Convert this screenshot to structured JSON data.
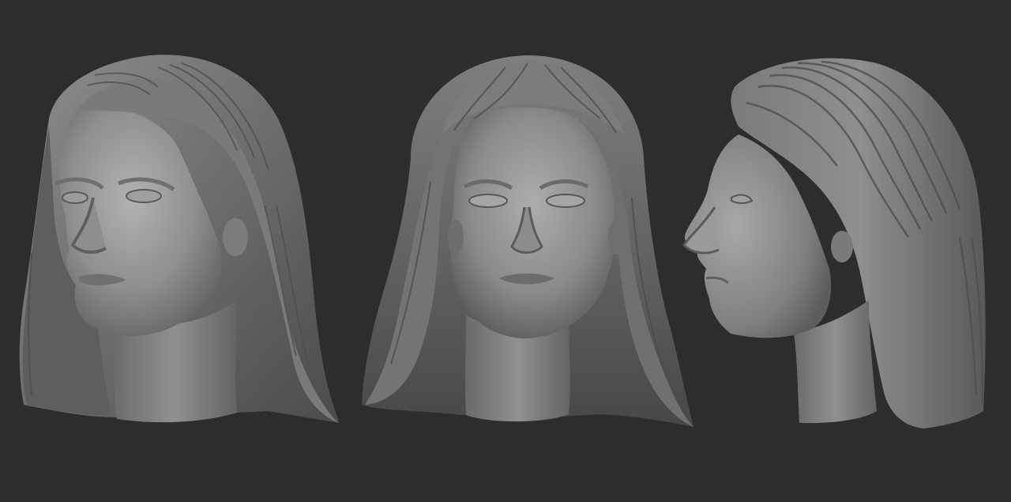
{
  "scene": {
    "background_color": "#2d2d2d",
    "clay_color": "#8a8a8a",
    "views": [
      {
        "id": "three-quarter",
        "icon": "sculpt-head-three-quarter-view"
      },
      {
        "id": "front",
        "icon": "sculpt-head-front-view"
      },
      {
        "id": "profile",
        "icon": "sculpt-head-side-profile-view"
      }
    ]
  }
}
